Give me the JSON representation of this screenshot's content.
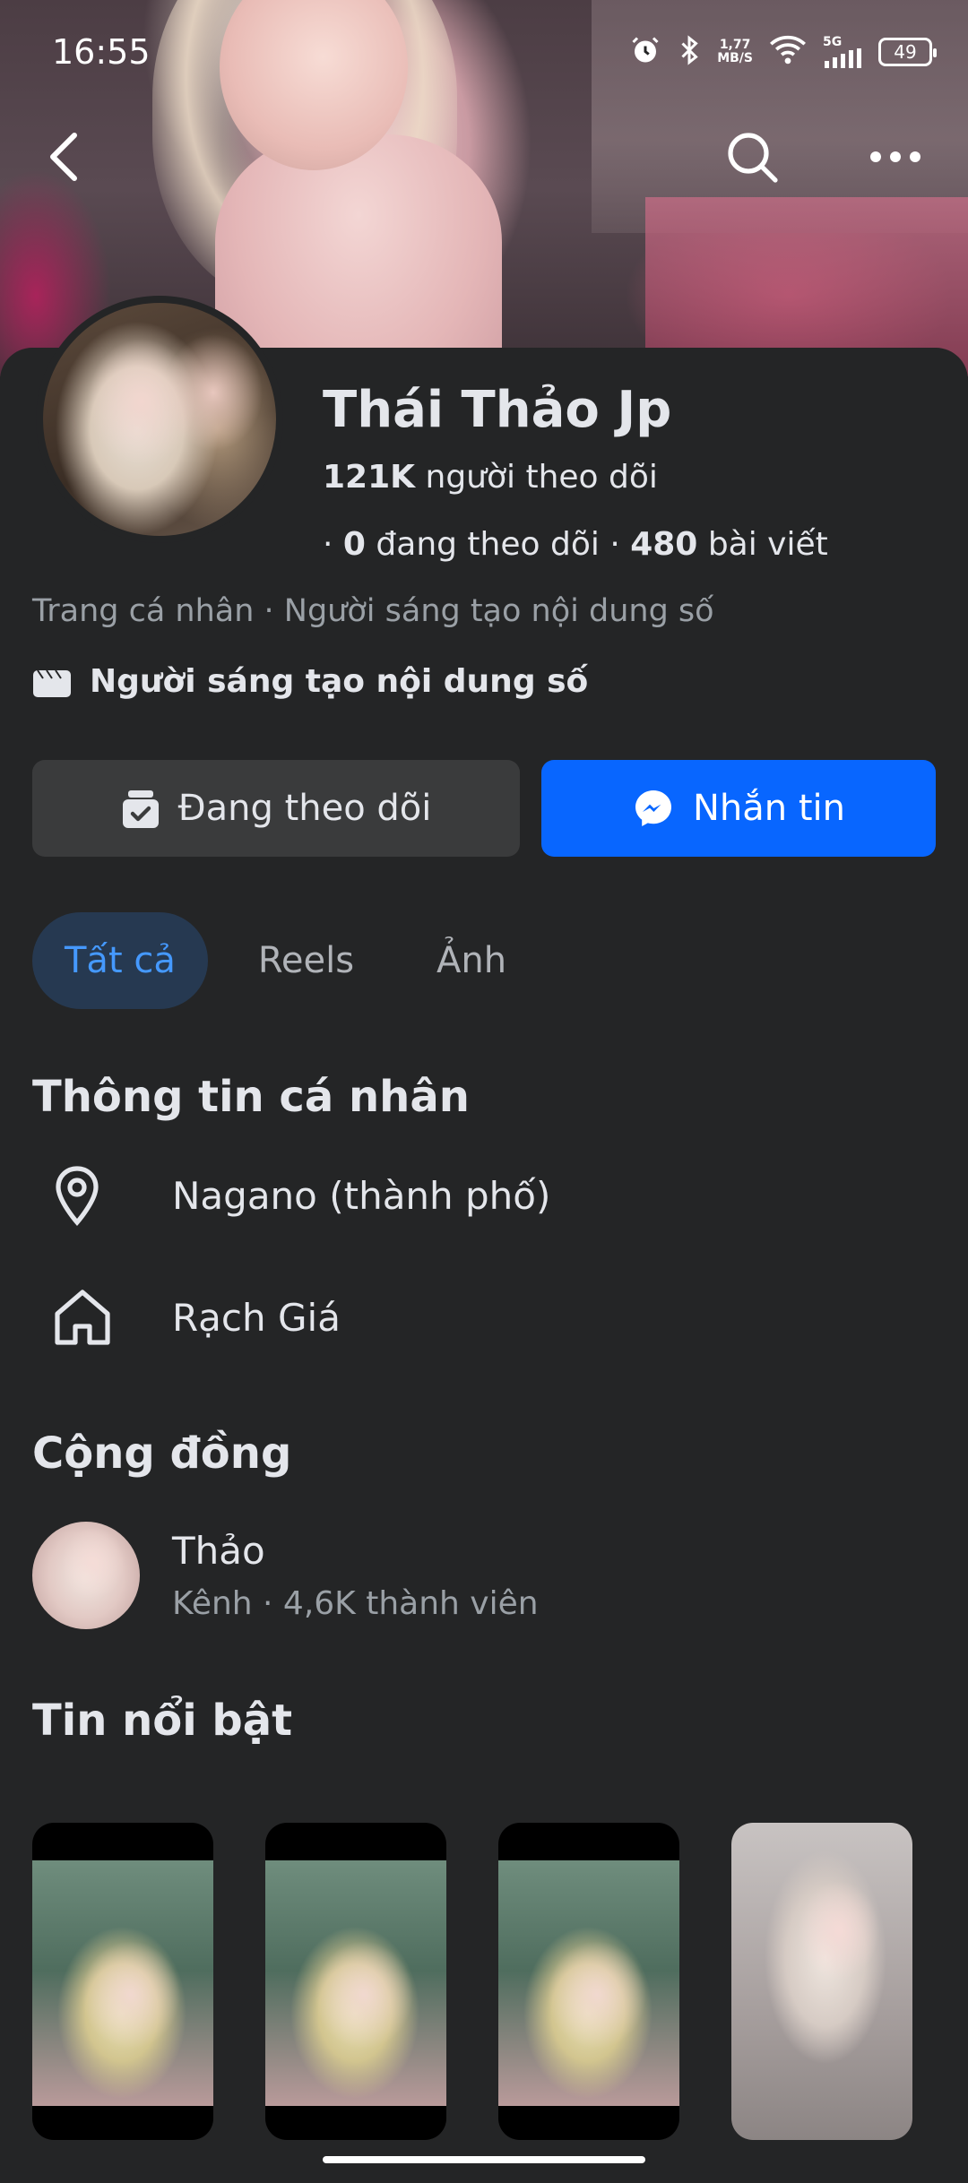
{
  "status_bar": {
    "time": "16:55",
    "net_speed_value": "1,77",
    "net_speed_unit": "MB/S",
    "network": "5G",
    "battery": "49"
  },
  "profile": {
    "name": "Thái Thảo Jp",
    "followers_count": "121K",
    "followers_label": "người theo dõi",
    "following_count": "0",
    "following_label": "đang theo dõi",
    "posts_count": "480",
    "posts_label": "bài viết",
    "subtitle": "Trang cá nhân · Người sáng tạo nội dung số",
    "creator_label": "Người sáng tạo nội dung số"
  },
  "actions": {
    "follow_label": "Đang theo dõi",
    "message_label": "Nhắn tin"
  },
  "tabs": [
    {
      "label": "Tất cả",
      "active": true
    },
    {
      "label": "Reels",
      "active": false
    },
    {
      "label": "Ảnh",
      "active": false
    }
  ],
  "personal_info": {
    "title": "Thông tin cá nhân",
    "items": [
      {
        "icon": "location-pin-icon",
        "text": "Nagano (thành phố)"
      },
      {
        "icon": "home-icon",
        "text": "Rạch Giá"
      }
    ]
  },
  "community": {
    "title": "Cộng đồng",
    "name": "Thảo",
    "meta": "Kênh · 4,6K thành viên"
  },
  "highlights": {
    "title": "Tin nổi bật"
  },
  "colors": {
    "background": "#242526",
    "primary_blue": "#0866ff",
    "active_tab_bg": "#263951",
    "active_tab_text": "#4599ff"
  }
}
